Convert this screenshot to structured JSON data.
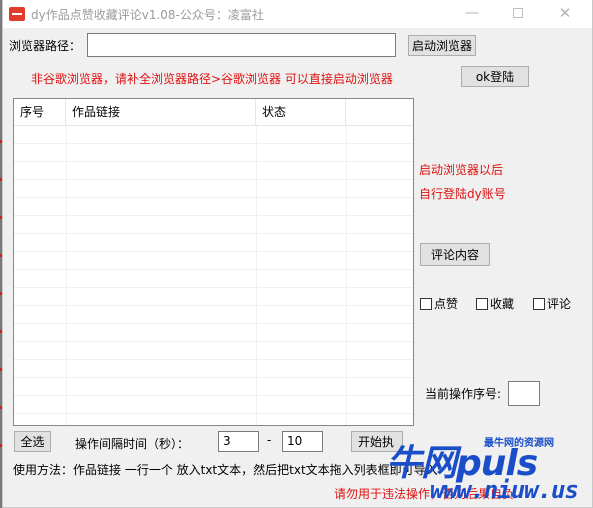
{
  "window": {
    "title": "dy作品点赞收藏评论v1.08-公众号：凌富社",
    "min_glyph": "—",
    "close_glyph": "✕"
  },
  "browser": {
    "path_label": "浏览器路径：",
    "path_value": "",
    "launch_button": "启动浏览器",
    "hint": "非谷歌浏览器，请补全浏览器路径>谷歌浏览器 可以直接启动浏览器",
    "ok_login_button": "ok登陆"
  },
  "table": {
    "columns": [
      "序号",
      "作品链接",
      "状态"
    ],
    "rows": []
  },
  "right_panel": {
    "hint_line1": "启动浏览器以后",
    "hint_line2": "自行登陆dy账号",
    "comment_button": "评论内容",
    "options": [
      {
        "label": "点赞",
        "checked": false
      },
      {
        "label": "收藏",
        "checked": false
      },
      {
        "label": "评论",
        "checked": false
      }
    ],
    "current_index_label": "当前操作序号:",
    "current_index_value": ""
  },
  "bottom": {
    "select_all_button": "全选",
    "interval_label": "操作间隔时间（秒）：",
    "interval_min": "3",
    "dash": "-",
    "interval_max": "10",
    "start_button": "开始执",
    "usage": "使用方法：作品链接 一行一个 放入txt文本，然后把txt文本拖入列表框即可导入",
    "warning": "请勿用于违法操作，否则后果自负"
  },
  "watermark": {
    "main": "牛网puls",
    "tagline": "最牛网的资源网",
    "url": "www.niuw.us"
  }
}
